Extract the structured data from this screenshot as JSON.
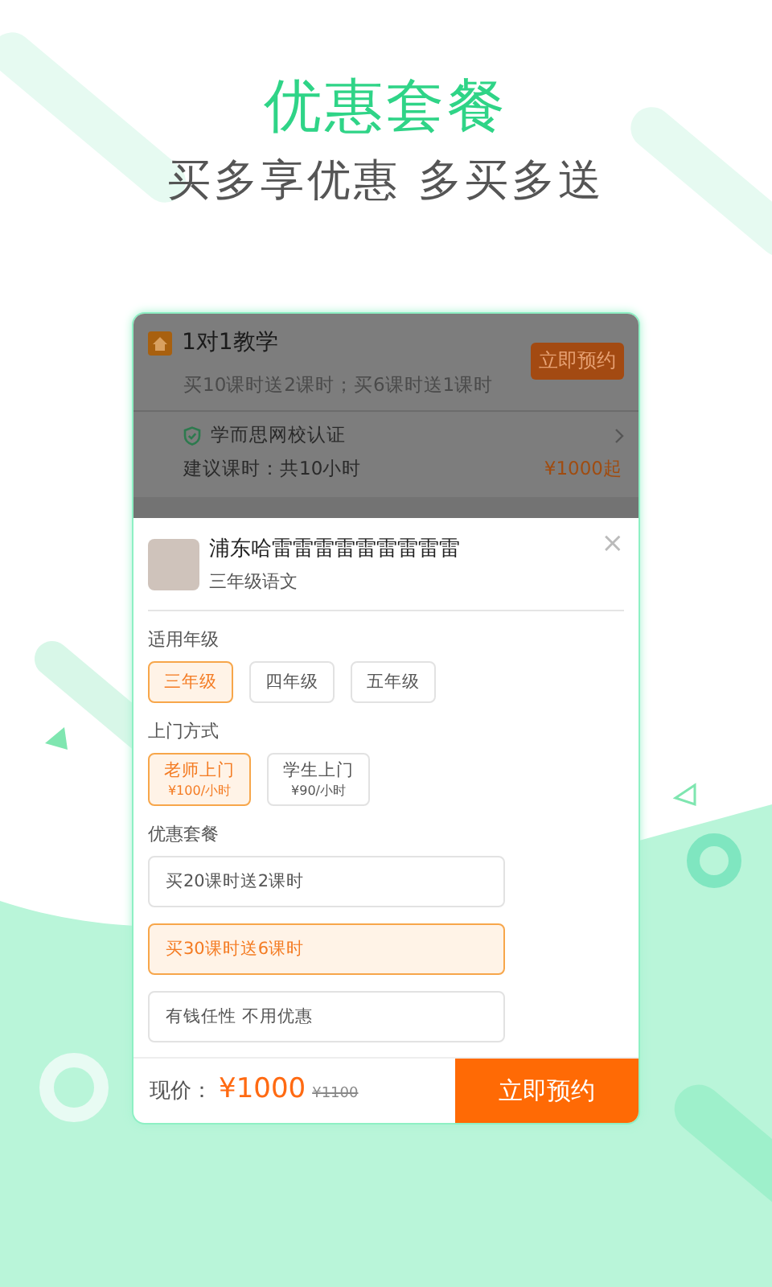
{
  "header": {
    "title": "优惠套餐",
    "subtitle": "买多享优惠 多买多送"
  },
  "course": {
    "title": "1对1教学",
    "promo": "买10课时送2课时；买6课时送1课时",
    "book_button": "立即预约",
    "verification": "学而思网校认证",
    "suggested_hours": "建议课时：共10小时",
    "price_from": "¥1000起"
  },
  "sheet": {
    "teacher_name": "浦东哈雷雷雷雷雷雷雷雷雷",
    "subject": "三年级语文",
    "close": "×",
    "sections": [
      {
        "label": "适用年级",
        "kind": "chips",
        "options": [
          {
            "label": "三年级",
            "selected": true
          },
          {
            "label": "四年级",
            "selected": false
          },
          {
            "label": "五年级",
            "selected": false
          }
        ]
      },
      {
        "label": "上门方式",
        "kind": "price-chips",
        "options": [
          {
            "label": "老师上门",
            "price": "¥100/小时",
            "selected": true
          },
          {
            "label": "学生上门",
            "price": "¥90/小时",
            "selected": false
          }
        ]
      },
      {
        "label": "优惠套餐",
        "kind": "rows",
        "options": [
          {
            "label": "买20课时送2课时",
            "selected": false
          },
          {
            "label": "买30课时送6课时",
            "selected": true
          },
          {
            "label": "有钱任性 不用优惠",
            "selected": false
          }
        ]
      }
    ]
  },
  "footer": {
    "price_label": "现价：",
    "price": "¥1000",
    "original_price": "¥1100",
    "book_button": "立即预约"
  }
}
